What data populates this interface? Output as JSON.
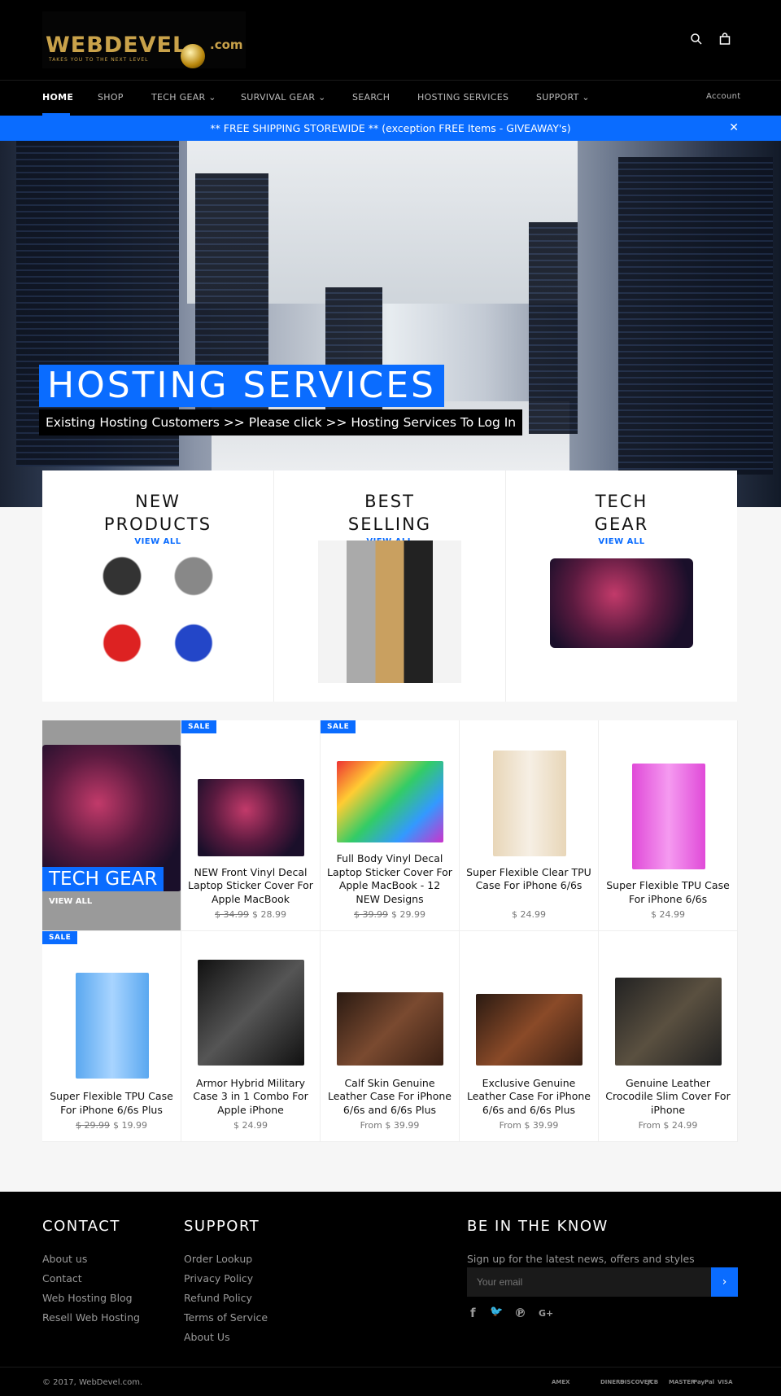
{
  "header": {
    "logo_text": "WEBDEVEL .com",
    "logo_tagline": "TAKES YOU TO THE NEXT LEVEL",
    "icons": [
      "search-icon",
      "cart-icon"
    ]
  },
  "nav": {
    "items": [
      "HOME",
      "SHOP",
      "TECH GEAR ⌄",
      "SURVIVAL GEAR ⌄",
      "SEARCH",
      "HOSTING SERVICES",
      "SUPPORT ⌄"
    ],
    "account": "Account"
  },
  "banner": {
    "text": "** FREE SHIPPING STOREWIDE ** (exception FREE Items - GIVEAWAY's)",
    "close": "✕"
  },
  "hero": {
    "title": "HOSTING SERVICES",
    "subtitle": "Existing Hosting Customers >> Please click >> Hosting Services To Log In"
  },
  "collections": [
    {
      "line1": "NEW",
      "line2": "PRODUCTS",
      "link": "VIEW ALL"
    },
    {
      "line1": "BEST",
      "line2": "SELLING",
      "link": "VIEW ALL"
    },
    {
      "line1": "TECH",
      "line2": "GEAR",
      "link": "VIEW ALL"
    }
  ],
  "featured": {
    "title": "TECH GEAR",
    "link": "VIEW ALL"
  },
  "sale_label": "SALE",
  "products": [
    {
      "title": "NEW Front Vinyl Decal Laptop Sticker Cover For Apple MacBook",
      "old": "$ 34.99",
      "price": "$ 28.99",
      "sale": true
    },
    {
      "title": "Full Body Vinyl Decal Laptop Sticker Cover For Apple MacBook - 12 NEW Designs",
      "old": "$ 39.99",
      "price": "$ 29.99",
      "sale": true
    },
    {
      "title": "Super Flexible Clear TPU Case For iPhone 6/6s",
      "old": "",
      "price": "$ 24.99",
      "sale": false
    },
    {
      "title": "Super Flexible TPU Case For iPhone 6/6s",
      "old": "",
      "price": "$ 24.99",
      "sale": false
    },
    {
      "title": "Super Flexible TPU Case For iPhone 6/6s Plus",
      "old": "$ 29.99",
      "price": "$ 19.99",
      "sale": true
    },
    {
      "title": "Armor Hybrid Military Case 3 in 1 Combo For Apple iPhone",
      "old": "",
      "price": "$ 24.99",
      "sale": false
    },
    {
      "title": "Calf Skin Genuine Leather Case For iPhone 6/6s and 6/6s Plus",
      "old": "",
      "price": "From $ 39.99",
      "sale": false
    },
    {
      "title": "Exclusive Genuine Leather Case For iPhone 6/6s and 6/6s Plus",
      "old": "",
      "price": "From $ 39.99",
      "sale": false
    },
    {
      "title": "Genuine Leather Crocodile Slim Cover For iPhone",
      "old": "",
      "price": "From $ 24.99",
      "sale": false
    }
  ],
  "footer": {
    "contact": {
      "title": "CONTACT",
      "links": [
        "About us",
        "Contact",
        "Web Hosting Blog",
        "Resell Web Hosting"
      ]
    },
    "support": {
      "title": "SUPPORT",
      "links": [
        "Order Lookup",
        "Privacy Policy",
        "Refund Policy",
        "Terms of Service",
        "About Us"
      ]
    },
    "newsletter": {
      "title": "BE IN THE KNOW",
      "text": "Sign up for the latest news, offers and styles",
      "placeholder": "Your email",
      "button": "›"
    },
    "social": [
      "f",
      "🐦",
      "℗",
      "G+"
    ],
    "copyright": "© 2017, WebDevel.com.",
    "payments": [
      "AMEX",
      "DINERS",
      "DISCOVER",
      "JCB",
      "MASTER",
      "PayPal",
      "VISA"
    ]
  },
  "colors": {
    "accent": "#0a6cff",
    "background": "#000000"
  }
}
